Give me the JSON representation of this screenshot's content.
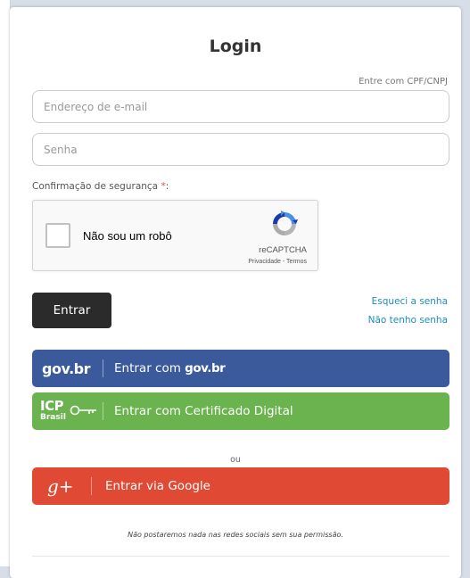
{
  "login": {
    "title": "Login",
    "cpf_link": "Entre com CPF/CNPJ",
    "email_placeholder": "Endereço de e-mail",
    "password_placeholder": "Senha",
    "security_label": "Confirmação de segurança",
    "required_mark": "*",
    "security_colon": ":",
    "submit_label": "Entrar",
    "forgot_link": "Esqueci a senha",
    "no_password_link": "Não tenho senha",
    "or_separator": "ou",
    "privacy_note": "Não postaremos nada nas redes sociais sem sua permissão."
  },
  "recaptcha": {
    "checkbox_label": "Não sou um robô",
    "brand": "reCAPTCHA",
    "terms": "Privacidade - Termos"
  },
  "social": {
    "govbr": {
      "logo_text": "gov.br",
      "label_prefix": "Entrar com ",
      "label_brand": "gov.br",
      "color": "#3a5a9b"
    },
    "icp": {
      "logo_text": "ICP",
      "logo_sub": "Brasil",
      "label": "Entrar com Certificado Digital",
      "color": "#6ab34e"
    },
    "google": {
      "logo_text": "g+",
      "label": "Entrar via Google",
      "color": "#e04a35"
    }
  }
}
